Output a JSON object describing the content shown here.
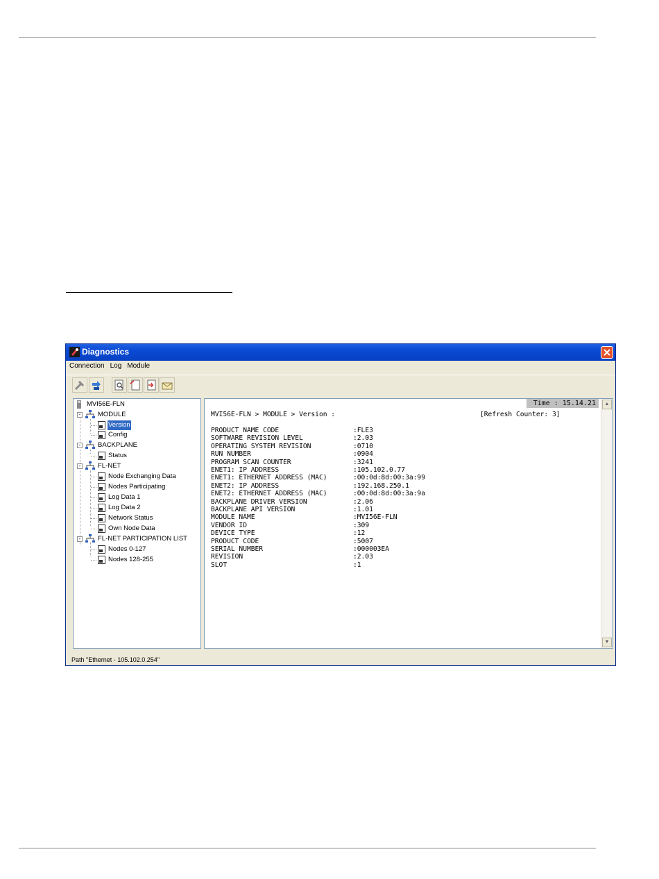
{
  "window": {
    "title": "Diagnostics",
    "menu": [
      "Connection",
      "Log",
      "Module"
    ],
    "toolbar_icons": [
      "disconnect-icon",
      "connect-icon",
      "find-icon",
      "file-icon",
      "send-icon",
      "mail-icon"
    ]
  },
  "tree": {
    "root": "MVI56E-FLN",
    "items": [
      {
        "label": "MVI56E-FLN",
        "level": 0,
        "icon": "device-icon"
      },
      {
        "label": "MODULE",
        "level": 1,
        "icon": "network-icon",
        "expander": "-"
      },
      {
        "label": "Version",
        "level": 2,
        "icon": "page-icon",
        "selected": true
      },
      {
        "label": "Config",
        "level": 2,
        "icon": "page-icon"
      },
      {
        "label": "BACKPLANE",
        "level": 1,
        "icon": "network-icon",
        "expander": "-"
      },
      {
        "label": "Status",
        "level": 2,
        "icon": "page-icon"
      },
      {
        "label": "FL-NET",
        "level": 1,
        "icon": "network-icon",
        "expander": "-"
      },
      {
        "label": "Node Exchanging Data",
        "level": 2,
        "icon": "page-icon"
      },
      {
        "label": "Nodes Participating",
        "level": 2,
        "icon": "page-icon"
      },
      {
        "label": "Log Data 1",
        "level": 2,
        "icon": "page-icon"
      },
      {
        "label": "Log Data 2",
        "level": 2,
        "icon": "page-icon"
      },
      {
        "label": "Network Status",
        "level": 2,
        "icon": "page-icon"
      },
      {
        "label": "Own Node Data",
        "level": 2,
        "icon": "page-icon"
      },
      {
        "label": "FL-NET PARTICIPATION LIST",
        "level": 1,
        "icon": "network-icon",
        "expander": "-"
      },
      {
        "label": "Nodes 0-127",
        "level": 2,
        "icon": "page-icon"
      },
      {
        "label": "Nodes 128-255",
        "level": 2,
        "icon": "page-icon"
      }
    ]
  },
  "content": {
    "time": "Time : 15.14.21",
    "breadcrumb": "MVI56E-FLN > MODULE > Version :",
    "refresh": "[Refresh Counter: 3]",
    "rows": [
      {
        "key": "PRODUCT NAME CODE",
        "value": ":FLE3"
      },
      {
        "key": "SOFTWARE REVISION LEVEL",
        "value": ":2.03"
      },
      {
        "key": "OPERATING SYSTEM REVISION",
        "value": ":0710"
      },
      {
        "key": "RUN NUMBER",
        "value": ":0904"
      },
      {
        "key": "PROGRAM SCAN COUNTER",
        "value": ":3241"
      },
      {
        "key": "ENET1: IP ADDRESS",
        "value": ":105.102.0.77"
      },
      {
        "key": "ENET1: ETHERNET ADDRESS (MAC)",
        "value": ":00:0d:8d:00:3a:99"
      },
      {
        "key": "ENET2: IP ADDRESS",
        "value": ":192.168.250.1"
      },
      {
        "key": "ENET2: ETHERNET ADDRESS (MAC)",
        "value": ":00:0d:8d:00:3a:9a"
      },
      {
        "key": "BACKPLANE DRIVER VERSION",
        "value": ":2.06"
      },
      {
        "key": "BACKPLANE API VERSION",
        "value": ":1.01"
      },
      {
        "key": "MODULE NAME",
        "value": ":MVI56E-FLN"
      },
      {
        "key": "VENDOR ID",
        "value": ":309"
      },
      {
        "key": "DEVICE TYPE",
        "value": ":12"
      },
      {
        "key": "PRODUCT CODE",
        "value": ":5007"
      },
      {
        "key": "SERIAL NUMBER",
        "value": ":000003EA"
      },
      {
        "key": "REVISION",
        "value": ":2.03"
      },
      {
        "key": "SLOT",
        "value": ":1"
      }
    ]
  },
  "statusbar": "Path \"Ethernet - 105.102.0.254\"",
  "colors": {
    "titlebar": "#0a4ad4",
    "selection": "#316ac5",
    "close": "#e3512a"
  }
}
